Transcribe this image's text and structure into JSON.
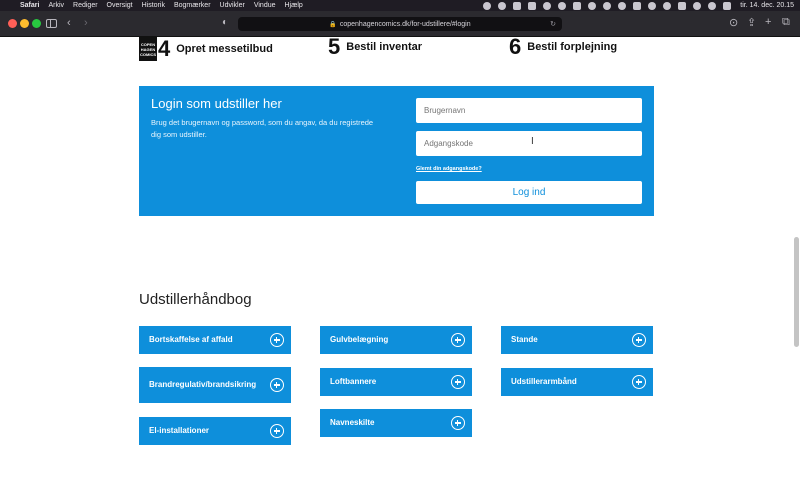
{
  "menubar": {
    "items": [
      "Safari",
      "Arkiv",
      "Rediger",
      "Oversigt",
      "Historik",
      "Bogmærker",
      "Udvikler",
      "Vindue",
      "Hjælp"
    ],
    "clock": "tir. 14. dec. 20.15"
  },
  "browser": {
    "url": "copenhagencomics.dk/for-udstillere/#login"
  },
  "steps": [
    {
      "number": "4",
      "title": "Opret messetilbud",
      "logo_text": "COPEN HAGEN COMICS"
    },
    {
      "number": "5",
      "title": "Bestil inventar"
    },
    {
      "number": "6",
      "title": "Bestil forplejning"
    }
  ],
  "login": {
    "title": "Login som udstiller her",
    "description": "Brug det brugernavn og password, som du angav, da du registrede dig som udstiller.",
    "username_placeholder": "Brugernavn",
    "password_placeholder": "Adgangskode",
    "forgot_label": "Glemt din adgangskode?",
    "submit_label": "Log ind"
  },
  "handbook": {
    "title": "Udstillerhåndbog",
    "items": [
      "Bortskaffelse af affald",
      "Brandregulativ/brandsikring",
      "El-installationer",
      "Gulvbelægning",
      "Loftbannere",
      "Navneskilte",
      "Stande",
      "Udstillerarmbånd"
    ]
  },
  "colors": {
    "brand_blue": "#0e8fdb",
    "menubar_bg": "#1f1c24",
    "toolbar_bg": "#2b2a2f"
  }
}
